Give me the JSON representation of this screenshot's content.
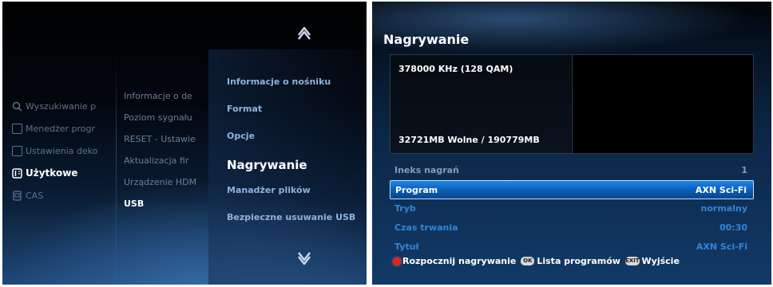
{
  "menu_screen": {
    "main_menu": [
      {
        "label": "Wyszukiwanie p",
        "icon": "search-icon",
        "active": false
      },
      {
        "label": "Menedżer progr",
        "icon": "tv-icon",
        "active": false
      },
      {
        "label": "Ustawienia deko",
        "icon": "settings-icon",
        "active": false
      },
      {
        "label": "Użytkowe",
        "icon": "tools-icon",
        "active": true
      },
      {
        "label": "CAS",
        "icon": "card-icon",
        "active": false
      }
    ],
    "sub_menu": [
      {
        "label": "Informacje o de",
        "active": false
      },
      {
        "label": "Poziom sygnału",
        "active": false
      },
      {
        "label": "RESET - Ustawie",
        "active": false
      },
      {
        "label": "Aktualizacja fir",
        "active": false
      },
      {
        "label": "Urządzenie HDM",
        "active": false
      },
      {
        "label": "USB",
        "active": true
      }
    ],
    "usb_menu": [
      {
        "label": "Informacje o nośniku",
        "active": false
      },
      {
        "label": "Format",
        "active": false
      },
      {
        "label": "Opcje",
        "active": false
      },
      {
        "label": "Nagrywanie",
        "active": true
      },
      {
        "label": "Manadżer plików",
        "active": false
      },
      {
        "label": "Bezpieczne usuwanie USB",
        "active": false
      }
    ]
  },
  "recording_screen": {
    "title": "Nagrywanie",
    "frequency": "378000 KHz (128 QAM)",
    "storage": "32721MB Wolne / 190779MB",
    "rows": [
      {
        "label": "Ineks nagrań",
        "value": "1",
        "style": "dim"
      },
      {
        "label": "Program",
        "value": "AXN Sci-Fi",
        "style": "sel"
      },
      {
        "label": "Tryb",
        "value": "normalny",
        "style": "blue"
      },
      {
        "label": "Czas trwania",
        "value": "00:30",
        "style": "blue"
      },
      {
        "label": "Tytuł",
        "value": "AXN Sci-Fi",
        "style": "blue"
      }
    ],
    "footer": {
      "start_label": "Rozpocznij nagrywanie",
      "ok_key": "OK",
      "list_label": "Lista programów",
      "exit_key": "EXIT",
      "exit_label": "Wyjście"
    }
  }
}
